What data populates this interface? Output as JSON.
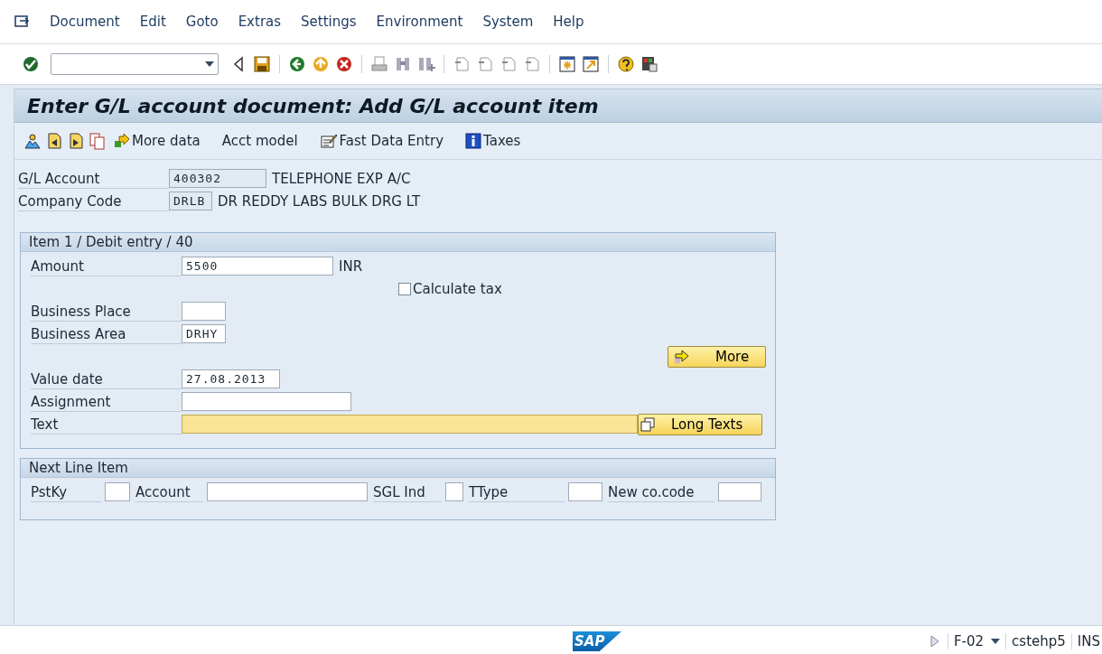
{
  "menu": [
    "Document",
    "Edit",
    "Goto",
    "Extras",
    "Settings",
    "Environment",
    "System",
    "Help"
  ],
  "title": "Enter G/L account document: Add G/L account item",
  "app_toolbar": [
    {
      "label": "More data",
      "kind": "arrow"
    },
    {
      "label": "Acct model",
      "kind": "plain"
    },
    {
      "label": "Fast Data Entry",
      "kind": "form"
    },
    {
      "label": "Taxes",
      "kind": "info"
    }
  ],
  "header_fields": [
    {
      "label": "G/L Account",
      "value": "400302",
      "description": "TELEPHONE EXP A/C"
    },
    {
      "label": "Company Code",
      "value": "DRLB",
      "description": "DR REDDY LABS BULK DRG LT"
    }
  ],
  "item_group": {
    "title": "Item 1 / Debit entry / 40",
    "amount": {
      "label": "Amount",
      "value": "5500",
      "unit": "INR"
    },
    "calculate_tax": {
      "label": "Calculate tax",
      "checked": false
    },
    "business_place": {
      "label": "Business Place"
    },
    "business_area": {
      "label": "Business Area",
      "value": "DRHY"
    },
    "more_button": "More",
    "value_date": {
      "label": "Value date",
      "value": "27.08.2013"
    },
    "assignment": {
      "label": "Assignment"
    },
    "text": {
      "label": "Text",
      "focused": true
    },
    "long_texts_button": "Long Texts"
  },
  "next_line_item": {
    "title": "Next Line Item",
    "fields": [
      {
        "label": "PstKy"
      },
      {
        "label": "Account"
      },
      {
        "label": "SGL Ind"
      },
      {
        "label": "TType"
      },
      {
        "label": "New co.code"
      }
    ]
  },
  "status_bar": {
    "logo_text": "SAP",
    "transaction": "F-02",
    "server": "cstehp5",
    "mode": "INS"
  }
}
